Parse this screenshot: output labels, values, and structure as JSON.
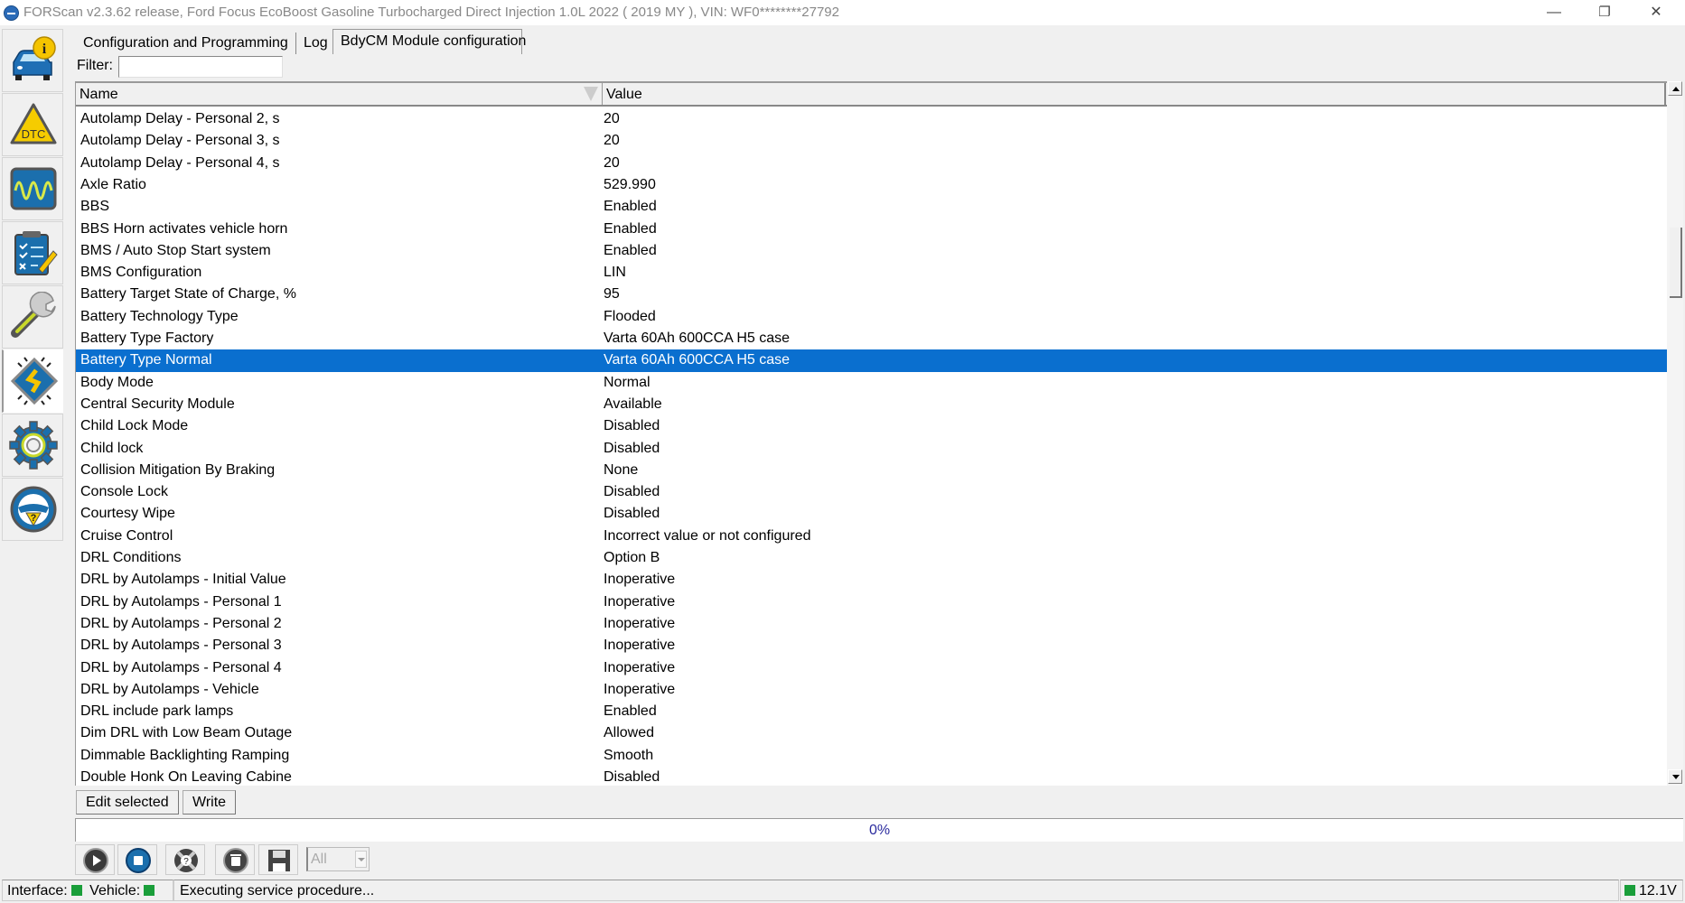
{
  "window": {
    "title": "FORScan v2.3.62 release, Ford Focus EcoBoost Gasoline Turbocharged Direct Injection 1.0L 2022 ( 2019 MY ), VIN: WF0********27792",
    "minimize_glyph": "—",
    "restore_glyph": "❐",
    "close_glyph": "✕"
  },
  "sidebar": {
    "items": [
      {
        "name": "vehicle-info",
        "icon": "car-info-icon"
      },
      {
        "name": "dtc",
        "icon": "dtc-warning-icon"
      },
      {
        "name": "oscilloscope",
        "icon": "oscilloscope-icon"
      },
      {
        "name": "tests",
        "icon": "checklist-icon"
      },
      {
        "name": "service",
        "icon": "wrench-icon"
      },
      {
        "name": "configuration",
        "icon": "chip-icon",
        "active": true
      },
      {
        "name": "settings",
        "icon": "gear-icon"
      },
      {
        "name": "help",
        "icon": "steering-help-icon"
      }
    ]
  },
  "tabs": [
    {
      "label": "Configuration and Programming"
    },
    {
      "label": "Log"
    },
    {
      "label": "BdyCM Module configuration",
      "active": true
    }
  ],
  "filter": {
    "label": "Filter:",
    "value": "",
    "placeholder": ""
  },
  "table": {
    "columns": {
      "name": "Name",
      "value": "Value"
    },
    "selected_index": 11,
    "rows": [
      {
        "name": "Autolamp Delay - Personal 2, s",
        "value": "20"
      },
      {
        "name": "Autolamp Delay - Personal 3, s",
        "value": "20"
      },
      {
        "name": "Autolamp Delay - Personal 4, s",
        "value": "20"
      },
      {
        "name": "Axle Ratio",
        "value": "529.990"
      },
      {
        "name": "BBS",
        "value": "Enabled"
      },
      {
        "name": "BBS Horn activates vehicle horn",
        "value": "Enabled"
      },
      {
        "name": "BMS / Auto Stop Start system",
        "value": "Enabled"
      },
      {
        "name": "BMS Configuration",
        "value": "LIN"
      },
      {
        "name": "Battery Target State of Charge, %",
        "value": "95"
      },
      {
        "name": "Battery Technology Type",
        "value": "Flooded"
      },
      {
        "name": "Battery Type Factory",
        "value": "Varta 60Ah 600CCA H5 case"
      },
      {
        "name": "Battery Type Normal",
        "value": "Varta 60Ah 600CCA H5 case"
      },
      {
        "name": "Body Mode",
        "value": "Normal"
      },
      {
        "name": "Central Security Module",
        "value": "Available"
      },
      {
        "name": "Child Lock Mode",
        "value": "Disabled"
      },
      {
        "name": "Child lock",
        "value": "Disabled"
      },
      {
        "name": "Collision Mitigation By Braking",
        "value": "None"
      },
      {
        "name": "Console Lock",
        "value": "Disabled"
      },
      {
        "name": "Courtesy Wipe",
        "value": "Disabled"
      },
      {
        "name": "Cruise Control",
        "value": "Incorrect value or not configured"
      },
      {
        "name": "DRL Conditions",
        "value": "Option B"
      },
      {
        "name": "DRL by Autolamps - Initial Value",
        "value": "Inoperative"
      },
      {
        "name": "DRL by Autolamps - Personal 1",
        "value": "Inoperative"
      },
      {
        "name": "DRL by Autolamps - Personal 2",
        "value": "Inoperative"
      },
      {
        "name": "DRL by Autolamps - Personal 3",
        "value": "Inoperative"
      },
      {
        "name": "DRL by Autolamps - Personal 4",
        "value": "Inoperative"
      },
      {
        "name": "DRL by Autolamps - Vehicle",
        "value": "Inoperative"
      },
      {
        "name": "DRL include park lamps",
        "value": "Enabled"
      },
      {
        "name": "Dim DRL with Low Beam Outage",
        "value": "Allowed"
      },
      {
        "name": "Dimmable Backlighting Ramping",
        "value": "Smooth"
      },
      {
        "name": "Double Honk On Leaving Cabine",
        "value": "Disabled"
      }
    ]
  },
  "actions": {
    "edit_label": "Edit selected",
    "write_label": "Write"
  },
  "progress": {
    "percent": 0,
    "label": "0%"
  },
  "toolbar": {
    "buttons": [
      {
        "name": "run",
        "icon": "play-icon"
      },
      {
        "name": "stop",
        "icon": "stop-icon"
      },
      {
        "name": "help",
        "icon": "lifebuoy-help-icon"
      },
      {
        "name": "clear",
        "icon": "trash-icon"
      },
      {
        "name": "save",
        "icon": "floppy-icon"
      }
    ],
    "filter_select": {
      "value": "All"
    }
  },
  "status": {
    "interface_label": "Interface:",
    "vehicle_label": "Vehicle:",
    "message": "Executing service procedure...",
    "voltage": "12.1V",
    "ok_color": "#1a9e3a"
  },
  "colors": {
    "selection": "#0a6fcf",
    "progress_text": "#2b2b9e"
  }
}
